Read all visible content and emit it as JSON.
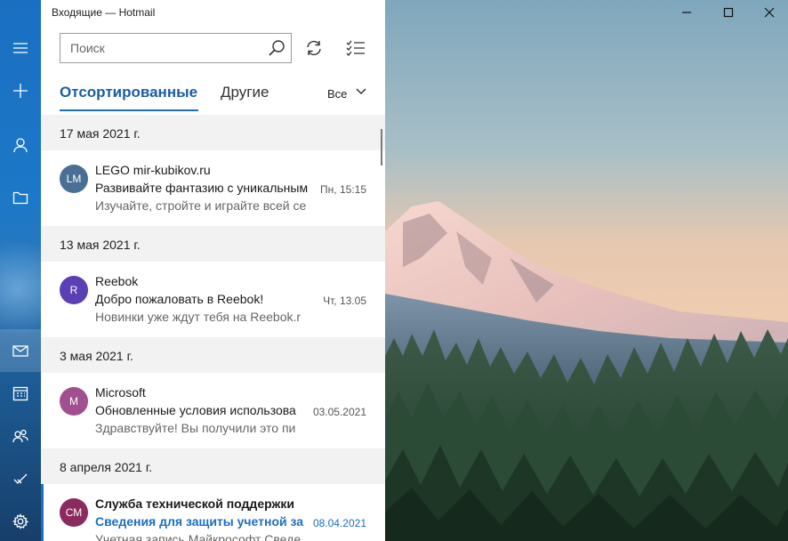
{
  "window": {
    "title": "Входящие — Hotmail",
    "controls": [
      "minimize-icon",
      "maximize-icon",
      "close-icon"
    ]
  },
  "rail": {
    "items": [
      {
        "name": "menu",
        "icon": "hamburger-icon"
      },
      {
        "name": "new-mail",
        "icon": "plus-icon"
      },
      {
        "name": "accounts",
        "icon": "person-icon"
      },
      {
        "name": "folders",
        "icon": "folder-icon"
      },
      {
        "name": "mail",
        "icon": "mail-icon",
        "active": true
      },
      {
        "name": "calendar",
        "icon": "calendar-icon"
      },
      {
        "name": "people",
        "icon": "people-icon"
      },
      {
        "name": "todo",
        "icon": "checkmark-icon"
      },
      {
        "name": "settings",
        "icon": "gear-icon"
      }
    ]
  },
  "search": {
    "placeholder": "Поиск",
    "value": ""
  },
  "tabs": {
    "focused": "Отсортированные",
    "other": "Другие",
    "active": "focused"
  },
  "filter": {
    "label": "Все"
  },
  "groups": [
    {
      "date": "17 мая 2021 г.",
      "messages": [
        {
          "initials": "LM",
          "avatar_color": "#4a6f94",
          "sender": "LEGO mir-kubikov.ru",
          "subject": "Развивайте фантазию с уникальным",
          "preview": "Изучайте, стройте и играйте всей се",
          "date": "Пн, 15:15",
          "unread": false
        }
      ]
    },
    {
      "date": "13 мая 2021 г.",
      "messages": [
        {
          "initials": "R",
          "avatar_color": "#5b3fb5",
          "sender": "Reebok",
          "subject": "Добро пожаловать в Reebok!",
          "preview": "Новинки уже ждут тебя на Reebok.r",
          "date": "Чт, 13.05",
          "unread": false
        }
      ]
    },
    {
      "date": "3 мая 2021 г.",
      "messages": [
        {
          "initials": "M",
          "avatar_color": "#a0508f",
          "sender": "Microsoft",
          "subject": "Обновленные условия использова",
          "preview": "Здравствуйте! Вы получили это пи",
          "date": "03.05.2021",
          "unread": false
        }
      ]
    },
    {
      "date": "8 апреля 2021 г.",
      "messages": [
        {
          "initials": "СМ",
          "avatar_color": "#8a2a5e",
          "sender": "Служба технической поддержки",
          "subject": "Сведения для защиты учетной за",
          "preview": "Учетная запись Майкрософт Сведе",
          "date": "08.04.2021",
          "unread": true
        }
      ]
    }
  ],
  "colors": {
    "accent": "#1b6ec2",
    "rail": "#1d78c8"
  }
}
